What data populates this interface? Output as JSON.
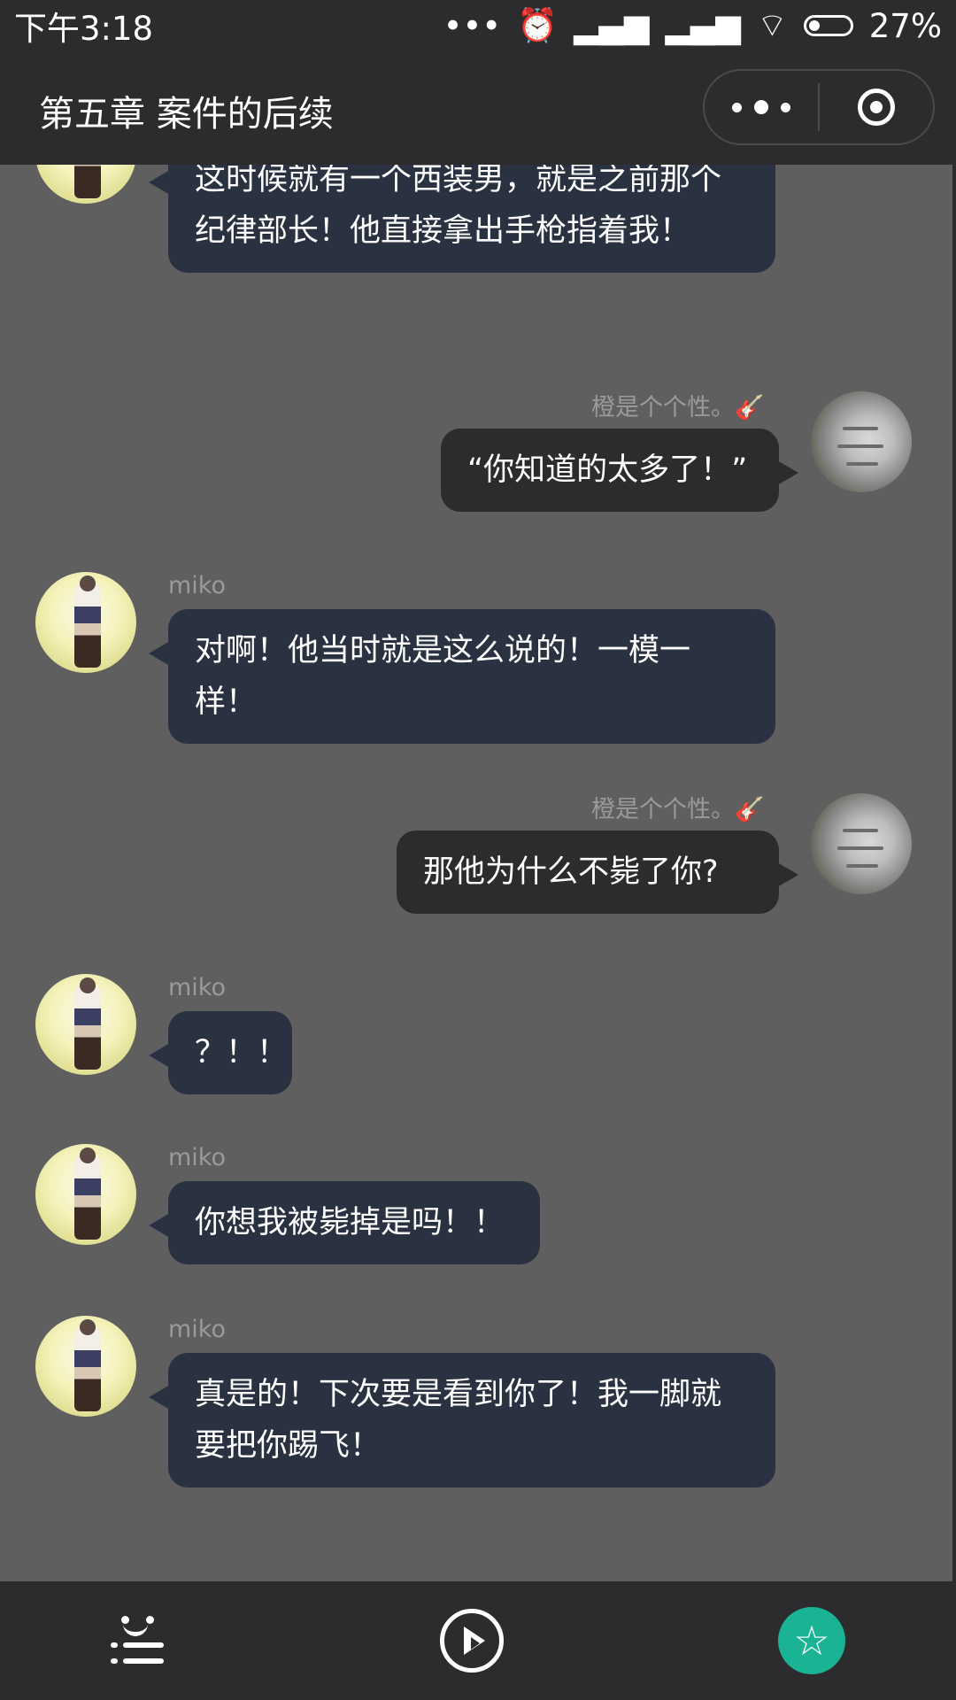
{
  "status_bar": {
    "time": "下午3:18",
    "battery": "27%",
    "icons": [
      "more-dots-icon",
      "alarm-icon",
      "signal-icon",
      "hd-signal-icon",
      "wifi-icon",
      "battery-icon"
    ]
  },
  "nav": {
    "title": "第五章 案件的后续",
    "more_icon": "more-icon",
    "close_icon": "target-icon"
  },
  "messages": [
    {
      "side": "left",
      "sender": "",
      "text": "这时候就有一个西装男，就是之前那个纪律部长！他直接拿出手枪指着我！"
    },
    {
      "side": "right",
      "sender": "橙是个个性。",
      "text": "“你知道的太多了！”"
    },
    {
      "side": "left",
      "sender": "miko",
      "text": "对啊！他当时就是这么说的！一模一样！"
    },
    {
      "side": "right",
      "sender": "橙是个个性。",
      "text": "那他为什么不毙了你?"
    },
    {
      "side": "left",
      "sender": "miko",
      "text": "？！！"
    },
    {
      "side": "left",
      "sender": "miko",
      "text": "你想我被毙掉是吗！！"
    },
    {
      "side": "left",
      "sender": "miko",
      "text": "真是的！下次要是看到你了！我一脚就要把你踢飞！"
    }
  ],
  "bottom_bar": {
    "icons": [
      "menu-face-icon",
      "play-icon",
      "star-icon"
    ],
    "accent": "#1ab394"
  },
  "colors": {
    "background": "#5f5f5f",
    "bar": "#2c2c2e",
    "left_bubble": "#2a3140",
    "right_bubble": "#2c2c2e",
    "name_text": "#9a9a9a"
  }
}
